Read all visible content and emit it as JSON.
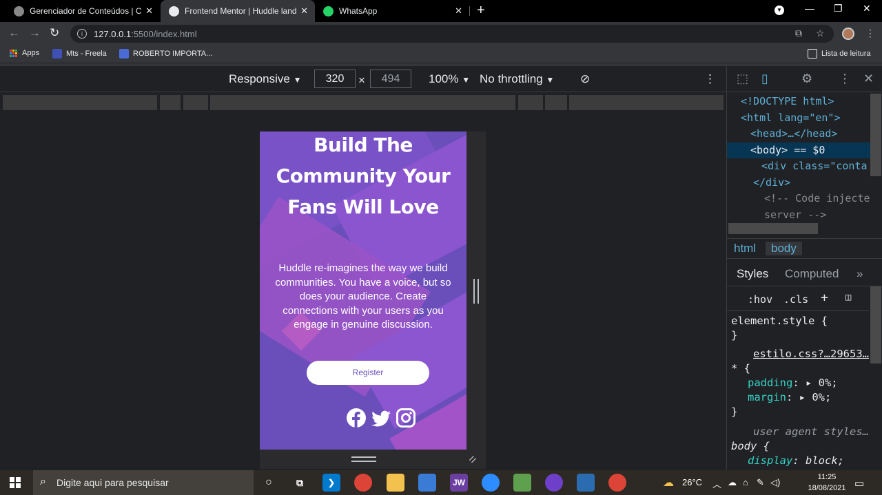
{
  "browser": {
    "tabs": [
      {
        "title": "Gerenciador de Conteúdos | C.F.",
        "active": false
      },
      {
        "title": "Frontend Mentor | Huddle landin",
        "active": true
      },
      {
        "title": "WhatsApp",
        "active": false
      }
    ],
    "address": {
      "host": "127.0.0.1",
      "path": ":5500/index.html"
    },
    "bookmarks": [
      "Apps",
      "Mts - Freela",
      "ROBERTO IMPORTA..."
    ],
    "reading_list": "Lista de leitura"
  },
  "device_toolbar": {
    "mode": "Responsive",
    "width": "320",
    "height": "494",
    "times": "×",
    "zoom": "100%",
    "throttling": "No throttling"
  },
  "preview": {
    "title": "Build The Community Your Fans Will Love",
    "text": "Huddle re-imagines the way we build communities. You have a voice, but so does your audience. Create connections with your users as you engage in genuine discussion.",
    "register": "Register",
    "social": [
      "facebook-icon",
      "twitter-icon",
      "instagram-icon"
    ]
  },
  "devtools": {
    "dom": {
      "doctype": "<!DOCTYPE html>",
      "html_open": "<html lang=\"en\">",
      "head": "<head>…</head>",
      "body": "<body> == $0",
      "div": "<div class=\"conta",
      "div_close": "</div>",
      "comment1": "<!-- Code injecte",
      "comment2": "server -->"
    },
    "breadcrumbs": [
      "html",
      "body"
    ],
    "panel_tabs": [
      "Styles",
      "Computed"
    ],
    "filter": {
      "hov": ":hov",
      "cls": ".cls"
    },
    "rules": {
      "element_style": "element.style {",
      "close1": "}",
      "source": "estilo.css?…29653…",
      "selector": "* {",
      "p1": "padding",
      "v1": "0%;",
      "p2": "margin",
      "v2": "0%;",
      "close2": "}",
      "ua": "user agent styles…",
      "body_sel": "body {",
      "p3": "display",
      "v3": "block;"
    }
  },
  "taskbar": {
    "search_placeholder": "Digite aqui para pesquisar",
    "temperature": "26°C",
    "time": "11:25",
    "date": "18/08/2021"
  },
  "colors": {
    "hero": "#6a4fbb",
    "accent": "#5db0d7"
  }
}
